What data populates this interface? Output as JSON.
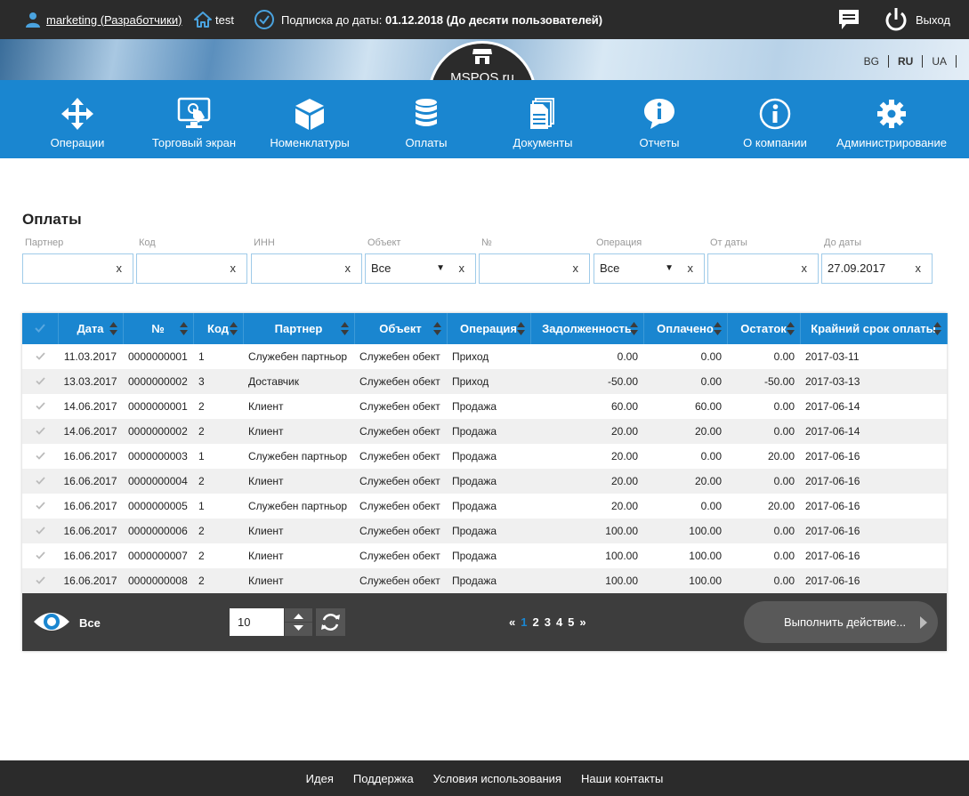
{
  "topbar": {
    "user": "marketing (Разработчики)",
    "store": "test",
    "subscription_prefix": "Подписка до даты: ",
    "subscription_value": "01.12.2018 (До десяти пользователей)",
    "logout": "Выход"
  },
  "logo": "MSPOS.ru",
  "languages": [
    "BG",
    "RU",
    "UA"
  ],
  "active_language": "RU",
  "nav": [
    {
      "label": "Операции",
      "icon": "arrows-move-icon"
    },
    {
      "label": "Торговый экран",
      "icon": "touch-screen-icon"
    },
    {
      "label": "Номенклатуры",
      "icon": "box-icon"
    },
    {
      "label": "Оплаты",
      "icon": "coins-icon"
    },
    {
      "label": "Документы",
      "icon": "documents-icon"
    },
    {
      "label": "Отчеты",
      "icon": "info-bubble-icon"
    },
    {
      "label": "О компании",
      "icon": "info-circle-icon"
    },
    {
      "label": "Администрирование",
      "icon": "gear-icon"
    }
  ],
  "page_title": "Оплаты",
  "filters": [
    {
      "label": "Партнер",
      "value": ""
    },
    {
      "label": "Код",
      "value": ""
    },
    {
      "label": "ИНН",
      "value": ""
    },
    {
      "label": "Объект",
      "value": "Все"
    },
    {
      "label": "№",
      "value": ""
    },
    {
      "label": "Операция",
      "value": "Все"
    },
    {
      "label": "От даты",
      "value": ""
    },
    {
      "label": "До даты",
      "value": "27.09.2017"
    }
  ],
  "clear_symbol": "x",
  "dropdown_symbol": "▼",
  "table": {
    "columns": [
      "Дата",
      "№",
      "Код",
      "Партнер",
      "Объект",
      "Операция",
      "Задолженность",
      "Оплачено",
      "Остаток",
      "Крайний срок оплаты"
    ],
    "rows": [
      [
        "11.03.2017",
        "0000000001",
        "1",
        "Служебен партньор",
        "Служебен обект",
        "Приход",
        "0.00",
        "0.00",
        "0.00",
        "2017-03-11"
      ],
      [
        "13.03.2017",
        "0000000002",
        "3",
        "Доставчик",
        "Служебен обект",
        "Приход",
        "-50.00",
        "0.00",
        "-50.00",
        "2017-03-13"
      ],
      [
        "14.06.2017",
        "0000000001",
        "2",
        "Клиент",
        "Служебен обект",
        "Продажа",
        "60.00",
        "60.00",
        "0.00",
        "2017-06-14"
      ],
      [
        "14.06.2017",
        "0000000002",
        "2",
        "Клиент",
        "Служебен обект",
        "Продажа",
        "20.00",
        "20.00",
        "0.00",
        "2017-06-14"
      ],
      [
        "16.06.2017",
        "0000000003",
        "1",
        "Служебен партньор",
        "Служебен обект",
        "Продажа",
        "20.00",
        "0.00",
        "20.00",
        "2017-06-16"
      ],
      [
        "16.06.2017",
        "0000000004",
        "2",
        "Клиент",
        "Служебен обект",
        "Продажа",
        "20.00",
        "20.00",
        "0.00",
        "2017-06-16"
      ],
      [
        "16.06.2017",
        "0000000005",
        "1",
        "Служебен партньор",
        "Служебен обект",
        "Продажа",
        "20.00",
        "0.00",
        "20.00",
        "2017-06-16"
      ],
      [
        "16.06.2017",
        "0000000006",
        "2",
        "Клиент",
        "Служебен обект",
        "Продажа",
        "100.00",
        "100.00",
        "0.00",
        "2017-06-16"
      ],
      [
        "16.06.2017",
        "0000000007",
        "2",
        "Клиент",
        "Служебен обект",
        "Продажа",
        "100.00",
        "100.00",
        "0.00",
        "2017-06-16"
      ],
      [
        "16.06.2017",
        "0000000008",
        "2",
        "Клиент",
        "Служебен обект",
        "Продажа",
        "100.00",
        "100.00",
        "0.00",
        "2017-06-16"
      ]
    ]
  },
  "table_footer": {
    "visibility_label": "Все",
    "per_page": "10",
    "pager_prev": "«",
    "pages": [
      "1",
      "2",
      "3",
      "4",
      "5"
    ],
    "current_page": "1",
    "pager_next": "»",
    "action_button": "Выполнить действие..."
  },
  "footer_links": [
    "Идея",
    "Поддержка",
    "Условия использования",
    "Наши контакты"
  ],
  "colors": {
    "primary": "#1a86d0",
    "dark": "#2b2b2b"
  }
}
